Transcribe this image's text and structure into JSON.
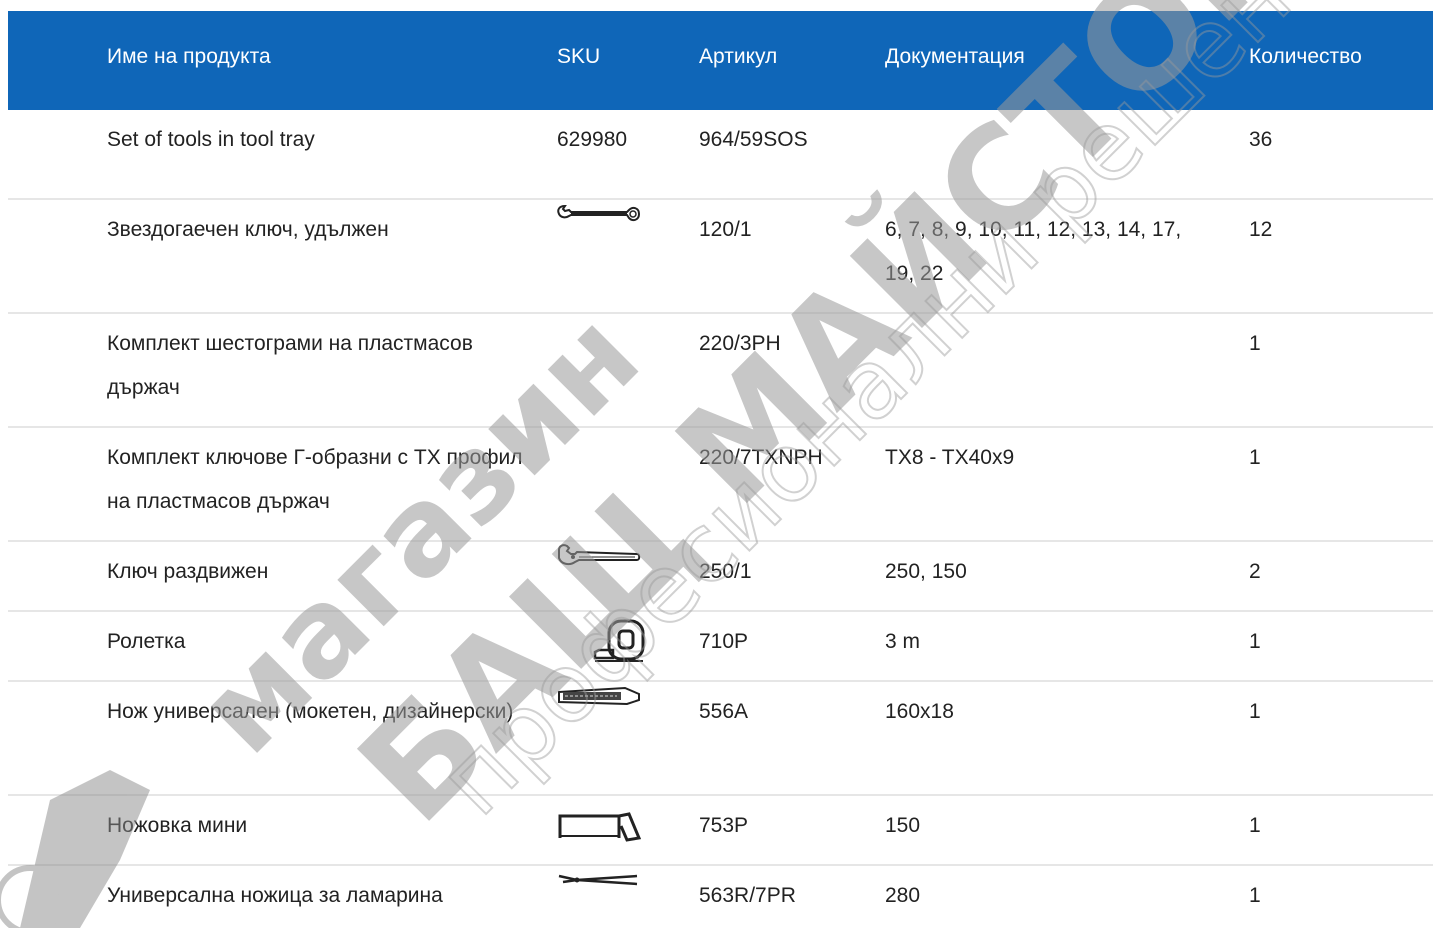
{
  "header": {
    "name": "Име на продукта",
    "sku": "SKU",
    "article": "Артикул",
    "documentation": "Документация",
    "quantity": "Количество"
  },
  "rows": [
    {
      "name": "Set of tools in tool tray",
      "sku": "629980",
      "sku_icon": "",
      "article": "964/59SOS",
      "doc": "",
      "qty": "36"
    },
    {
      "name": "Звездогаечен ключ, удължен",
      "sku": "",
      "sku_icon": "combination-wrench-icon",
      "article": "120/1",
      "doc": "6, 7, 8, 9, 10, 11, 12, 13, 14, 17, 19, 22",
      "qty": "12"
    },
    {
      "name": "Комплект шестограми на пластмасов държач",
      "sku": "",
      "sku_icon": "",
      "article": "220/3PH",
      "doc": "",
      "qty": "1"
    },
    {
      "name": "Комплект ключове Г-образни с TX профил на пластмасов държач",
      "sku": "",
      "sku_icon": "",
      "article": "220/7TXNPH",
      "doc": "TX8 - TX40x9",
      "qty": "1"
    },
    {
      "name": "Ключ раздвижен",
      "sku": "",
      "sku_icon": "adjustable-wrench-icon",
      "article": "250/1",
      "doc": "250, 150",
      "qty": "2"
    },
    {
      "name": "Ролетка",
      "sku": "",
      "sku_icon": "tape-measure-icon",
      "article": "710P",
      "doc": "3 m",
      "qty": "1"
    },
    {
      "name": "Нож универсален (мокетен, дизайнерски)",
      "sku": "",
      "sku_icon": "utility-knife-icon",
      "article": "556A",
      "doc": "160x18",
      "qty": "1"
    },
    {
      "name": "Ножовка мини",
      "sku": "",
      "sku_icon": "mini-hacksaw-icon",
      "article": "753P",
      "doc": "150",
      "qty": "1"
    },
    {
      "name": "Универсална ножица за ламарина",
      "sku": "",
      "sku_icon": "tin-snips-icon",
      "article": "563R/7PR",
      "doc": "280",
      "qty": "1"
    }
  ],
  "watermark": {
    "line1": "магазин",
    "line2": "БАЩ МАЙСТОР",
    "line3": "професионални решения"
  },
  "colors": {
    "header_bg": "#0f66b8",
    "header_text": "#ffffff",
    "row_divider": "#e6e6e6"
  }
}
